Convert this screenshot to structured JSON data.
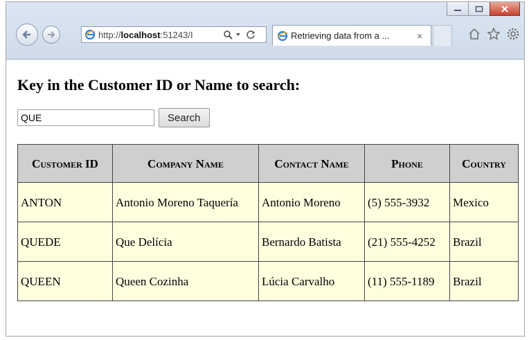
{
  "browser": {
    "url_prefix": "http://",
    "url_host": "localhost",
    "url_suffix": ":51243/I",
    "tab_title": "Retrieving data from a ...",
    "tab_close": "×"
  },
  "page": {
    "heading": "Key in the Customer ID or Name to search:",
    "search_value": "QUE",
    "search_button": "Search"
  },
  "table": {
    "headers": [
      "Customer ID",
      "Company Name",
      "Contact Name",
      "Phone",
      "Country"
    ],
    "rows": [
      [
        "ANTON",
        "Antonio Moreno Taquería",
        "Antonio Moreno",
        "(5) 555-3932",
        "Mexico"
      ],
      [
        "QUEDE",
        "Que Delícia",
        "Bernardo Batista",
        "(21) 555-4252",
        "Brazil"
      ],
      [
        "QUEEN",
        "Queen Cozinha",
        "Lúcia Carvalho",
        "(11) 555-1189",
        "Brazil"
      ]
    ]
  },
  "icons": {
    "back": "back-arrow-icon",
    "forward": "forward-arrow-icon",
    "ie": "internet-explorer-icon",
    "search": "search-icon",
    "refresh": "refresh-icon",
    "home": "home-icon",
    "favorites": "star-icon",
    "settings": "gear-icon"
  },
  "colors": {
    "table_header_bg": "#cfcfcf",
    "table_cell_bg": "#ffffe0",
    "close_button": "#c8432e",
    "ie_logo": "#2b7fd6"
  }
}
